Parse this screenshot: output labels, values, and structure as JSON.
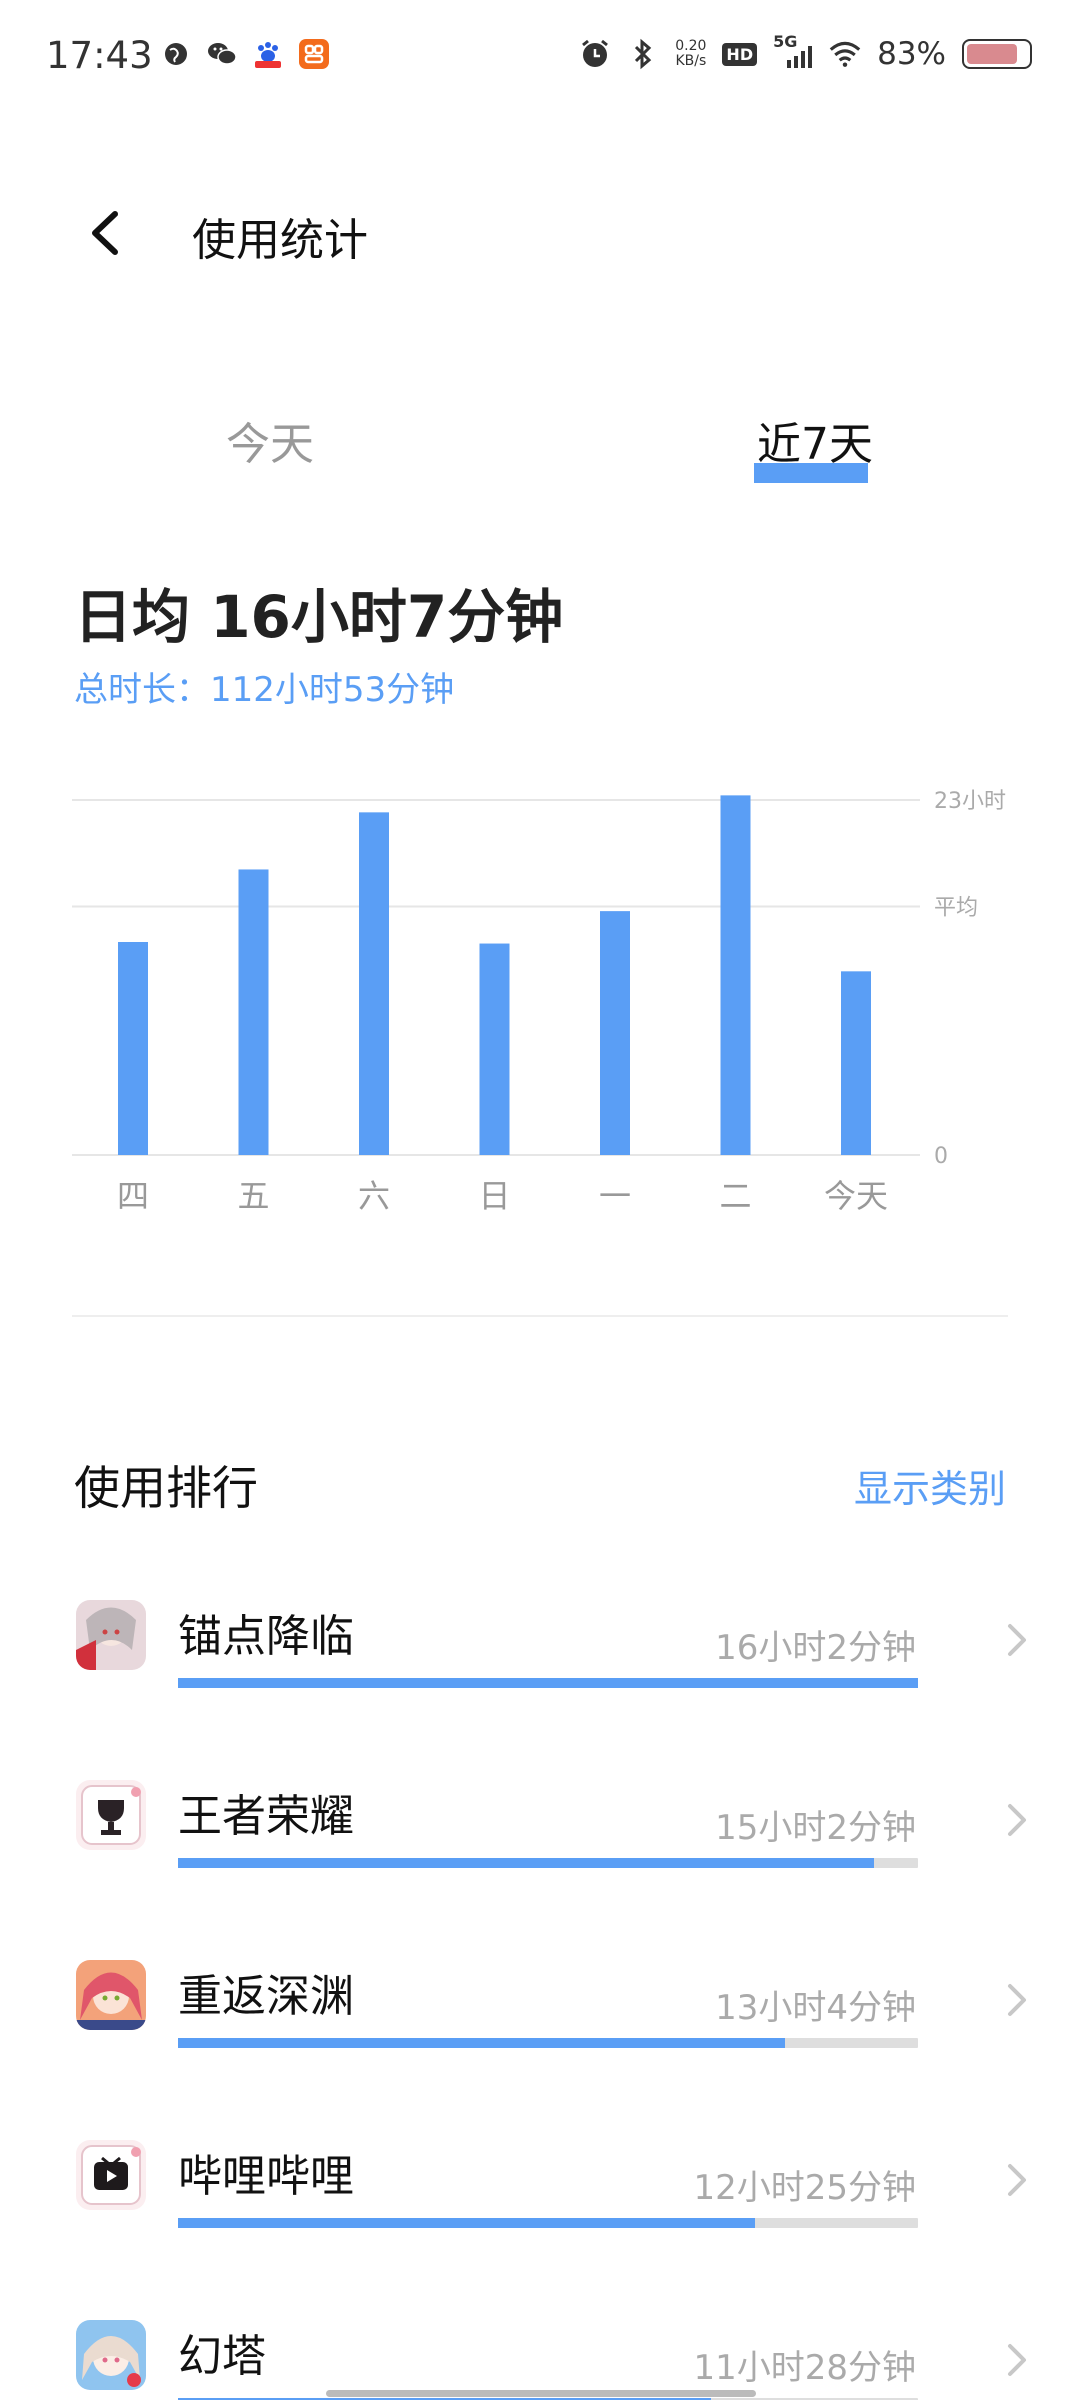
{
  "status_bar": {
    "time": "17:43",
    "net_speed_value": "0.20",
    "net_speed_unit": "KB/s",
    "hd": "HD",
    "network": "5G",
    "battery_text": "83%",
    "battery_level": 0.83,
    "left_icons": [
      "globe-icon",
      "wechat-icon",
      "baidu-icon",
      "orange-app-icon"
    ],
    "right_icons": [
      "alarm-icon",
      "bluetooth-icon",
      "signal-icon",
      "wifi-icon",
      "battery-icon"
    ]
  },
  "header": {
    "title": "使用统计"
  },
  "tabs": [
    {
      "label": "今天",
      "selected": false
    },
    {
      "label": "近7天",
      "selected": true
    }
  ],
  "summary": {
    "daily_avg": "日均 16小时7分钟",
    "total": "总时长：112小时53分钟"
  },
  "chart_data": {
    "type": "bar",
    "categories": [
      "四",
      "五",
      "六",
      "日",
      "一",
      "二",
      "今天"
    ],
    "values": [
      13.8,
      18.5,
      22.2,
      13.7,
      15.8,
      23.3,
      11.9
    ],
    "y_tick_labels": [
      "23小时",
      "平均",
      "0"
    ],
    "y_tick_values": [
      23,
      16.1,
      0
    ],
    "ylim": [
      0,
      24
    ],
    "bar_color": "#5a9ef5",
    "grid": true
  },
  "ranking": {
    "title": "使用排行",
    "action": "显示类别",
    "apps": [
      {
        "name": "锚点降临",
        "time": "16小时2分钟",
        "usage_fraction": 1.0,
        "icon": "anime-game-icon"
      },
      {
        "name": "王者荣耀",
        "time": "15小时2分钟",
        "usage_fraction": 0.94,
        "icon": "trophy-app-icon"
      },
      {
        "name": "重返深渊",
        "time": "13小时4分钟",
        "usage_fraction": 0.82,
        "icon": "anime-girl-icon"
      },
      {
        "name": "哔哩哔哩",
        "time": "12小时25分钟",
        "usage_fraction": 0.78,
        "icon": "tv-app-icon"
      },
      {
        "name": "幻塔",
        "time": "11小时28分钟",
        "usage_fraction": 0.72,
        "icon": "fantasy-game-icon"
      }
    ]
  },
  "colors": {
    "accent": "#5a9ef5",
    "track": "#dedede",
    "muted_text": "#aaaaaa"
  }
}
